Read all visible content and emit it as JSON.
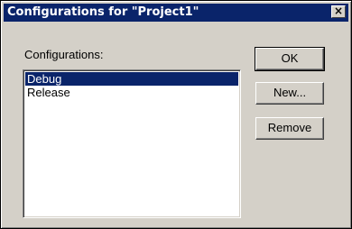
{
  "dialog": {
    "title": "Configurations for \"Project1\"",
    "close_glyph": "×"
  },
  "configurations": {
    "label": "Configurations:",
    "items": [
      {
        "label": "Debug",
        "selected": true
      },
      {
        "label": "Release",
        "selected": false
      }
    ]
  },
  "buttons": {
    "ok": "OK",
    "new": "New...",
    "remove": "Remove"
  },
  "colors": {
    "titlebar": "#0a246a",
    "face": "#d4d0c8",
    "selection": "#0a246a"
  }
}
